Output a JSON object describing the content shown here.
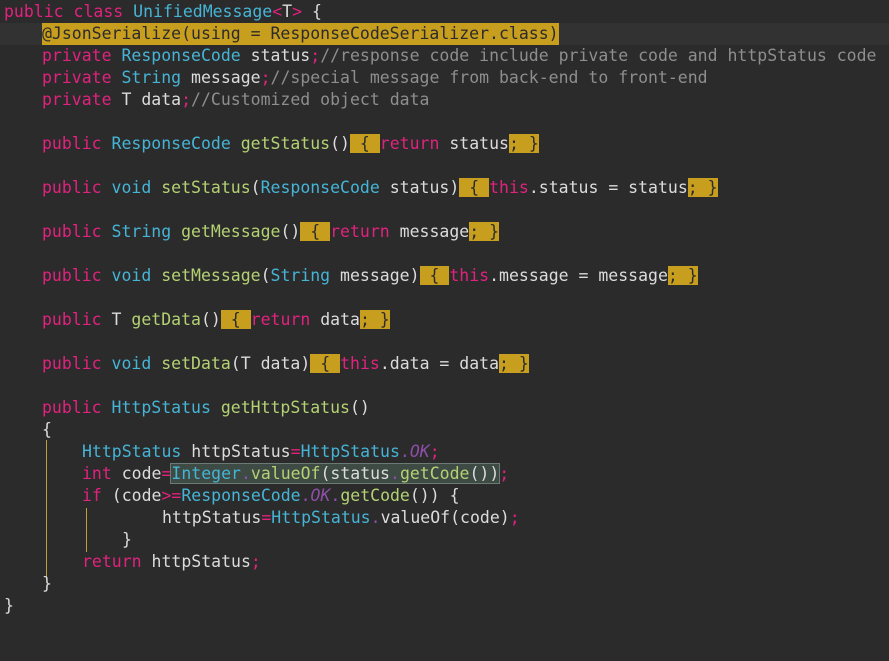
{
  "editor": {
    "language": "java",
    "colors": {
      "background": "#2b2b2b",
      "keyword": "#e1227e",
      "type": "#45b4d6",
      "function": "#b4d273",
      "comment": "#8e8e8e",
      "constant": "#8d4fa7",
      "highlight": "#c89e1e"
    },
    "lines": [
      {
        "id": "l1",
        "text_parts": [
          "public",
          " class ",
          "UnifiedMessage",
          "<",
          "T",
          ">",
          " {"
        ]
      },
      {
        "id": "l2",
        "text": "@JsonSerialize(using = ResponseCodeSerializer.class)"
      },
      {
        "id": "l3",
        "text_parts": [
          "private",
          " ",
          "ResponseCode",
          " status",
          ";",
          "//response code include private code and httpStatus code"
        ]
      },
      {
        "id": "l4",
        "text_parts": [
          "private",
          " ",
          "String",
          " message",
          ";",
          "//special message from back-end to front-end"
        ]
      },
      {
        "id": "l5",
        "text_parts": [
          "private",
          " T data",
          ";",
          "//Customized object data"
        ]
      },
      {
        "id": "l6",
        "text_parts": [
          "public",
          " ",
          "ResponseCode",
          " ",
          "getStatus",
          "()",
          " { ",
          "return",
          " status",
          ";",
          " }"
        ]
      },
      {
        "id": "l7",
        "text_parts": [
          "public",
          " ",
          "void",
          " ",
          "setStatus",
          "(",
          "ResponseCode",
          " status)",
          " { ",
          "this",
          ".status = status",
          ";",
          " }"
        ]
      },
      {
        "id": "l8",
        "text_parts": [
          "public",
          " ",
          "String",
          " ",
          "getMessage",
          "()",
          " { ",
          "return",
          " message",
          ";",
          " }"
        ]
      },
      {
        "id": "l9",
        "text_parts": [
          "public",
          " ",
          "void",
          " ",
          "setMessage",
          "(",
          "String",
          " message)",
          " { ",
          "this",
          ".message = message",
          ";",
          " }"
        ]
      },
      {
        "id": "l10",
        "text_parts": [
          "public",
          " T ",
          "getData",
          "()",
          " { ",
          "return",
          " data",
          ";",
          " }"
        ]
      },
      {
        "id": "l11",
        "text_parts": [
          "public",
          " ",
          "void",
          " ",
          "setData",
          "(T data)",
          " { ",
          "this",
          ".data = data",
          ";",
          " }"
        ]
      },
      {
        "id": "l12",
        "text_parts": [
          "public",
          " ",
          "HttpStatus",
          " ",
          "getHttpStatus",
          "()"
        ]
      },
      {
        "id": "l13",
        "text": "{"
      },
      {
        "id": "l14",
        "text_parts": [
          "HttpStatus",
          " httpStatus",
          "=",
          "HttpStatus",
          ".",
          "OK",
          ";"
        ]
      },
      {
        "id": "l15",
        "text_parts": [
          "int",
          " code",
          "=",
          "Integer",
          ".",
          "valueOf",
          "(",
          "status",
          ".",
          "getCode",
          "()",
          ")",
          ";"
        ]
      },
      {
        "id": "l16",
        "text_parts": [
          "if",
          " (code",
          ">=",
          "ResponseCode",
          ".",
          "OK",
          ".",
          "getCode",
          "()) {"
        ]
      },
      {
        "id": "l17",
        "text_parts": [
          "httpStatus",
          "=",
          "HttpStatus",
          ".",
          "valueOf",
          "(code)",
          ";"
        ]
      },
      {
        "id": "l18",
        "text": "}"
      },
      {
        "id": "l19",
        "text_parts": [
          "return",
          " httpStatus",
          ";"
        ]
      },
      {
        "id": "l20",
        "text": "}"
      },
      {
        "id": "l21",
        "text": "}"
      }
    ]
  }
}
